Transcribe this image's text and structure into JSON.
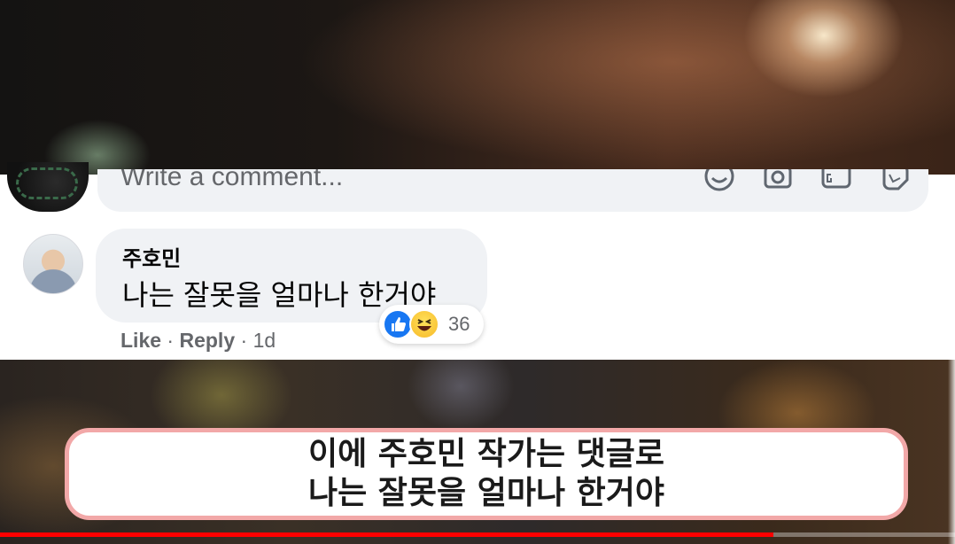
{
  "comment_input": {
    "placeholder": "Write a comment..."
  },
  "comment": {
    "author": "주호민",
    "text": "나는 잘못을 얼마나 한거야",
    "reactions": {
      "icons": [
        "like-icon",
        "haha-icon"
      ],
      "count": "36"
    },
    "actions": {
      "like": "Like",
      "separator1": " · ",
      "reply": "Reply",
      "separator2": " · ",
      "time": "1d"
    }
  },
  "subtitle": {
    "line1": "이에 주호민 작가는 댓글로",
    "line2": "나는 잘못을 얼마나 한거야"
  },
  "video": {
    "progress": 0.81,
    "progress_color": "#ff0000"
  },
  "colors": {
    "facebook_blue": "#1877f2",
    "bubble_bg": "#f0f2f5",
    "subtitle_border": "#f2a8a8"
  }
}
